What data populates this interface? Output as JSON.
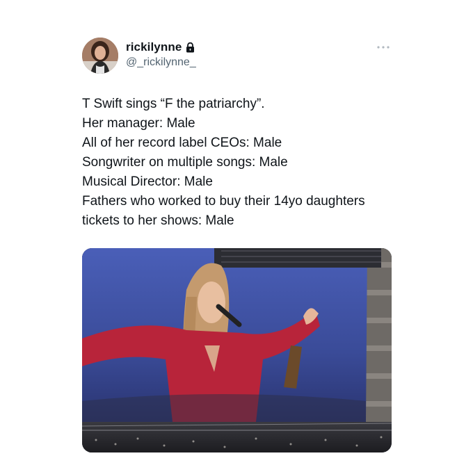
{
  "tweet": {
    "author": {
      "display_name": "rickilynne",
      "handle": "@_rickilynne_",
      "verified_icon": "lock-icon",
      "avatar_icon": "profile-photo"
    },
    "more_icon": "more-options-icon",
    "text_lines": [
      "T Swift sings “F the patriarchy”.",
      "Her manager: Male",
      "All of her record label CEOs: Male",
      "Songwriter on multiple songs: Male",
      "Musical Director: Male",
      "Fathers who worked to buy their 14yo daughters",
      "tickets to her shows: Male"
    ],
    "media": {
      "kind": "photo",
      "subject": "concert screen"
    }
  },
  "colors": {
    "text": "#0f1419",
    "secondary_text": "#536471",
    "background": "#ffffff",
    "screen_sky": "#3c4fa0",
    "dress_red": "#b8243a"
  }
}
